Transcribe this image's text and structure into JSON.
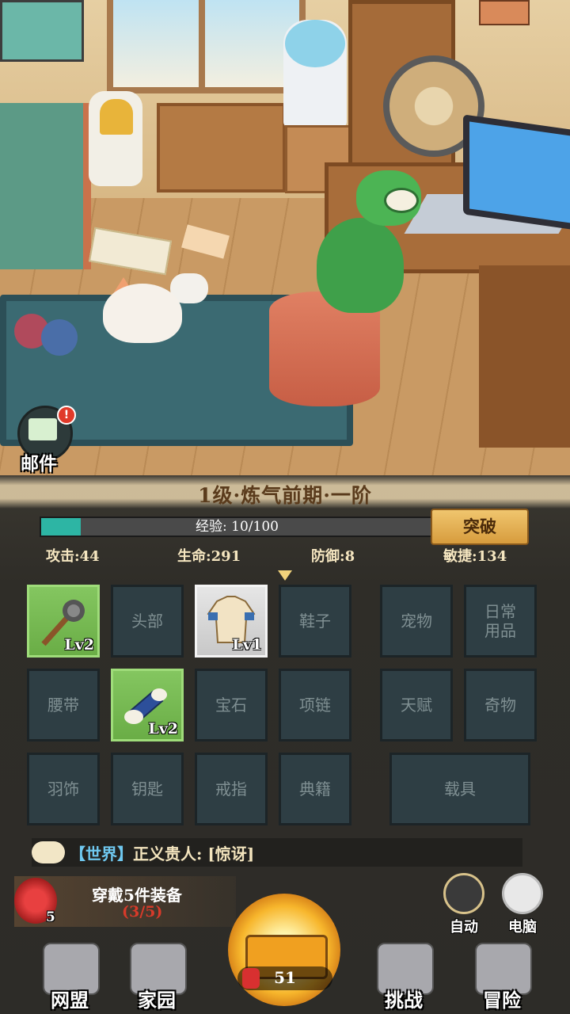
{
  "mail": {
    "label": "邮件",
    "badge": "!"
  },
  "realm": {
    "title": "1级·炼气前期·一阶"
  },
  "exp": {
    "label": "经验:",
    "value": "10/100",
    "progress": 0.1
  },
  "breakthrough_label": "突破",
  "stats": [
    {
      "text": "攻击:44"
    },
    {
      "text": "生命:291"
    },
    {
      "text": "防御:8"
    },
    {
      "text": "敏捷:134"
    }
  ],
  "slots": [
    {
      "label": "",
      "level": "Lv2",
      "icon": "mace-icon",
      "state": "green"
    },
    {
      "label": "头部",
      "level": "",
      "state": "empty"
    },
    {
      "label": "",
      "level": "Lv1",
      "icon": "shirt-icon",
      "state": "grey"
    },
    {
      "label": "鞋子",
      "level": "",
      "state": "empty"
    },
    {
      "label": "宠物",
      "level": "",
      "state": "empty"
    },
    {
      "label": "日常\n用品",
      "level": "",
      "state": "empty"
    },
    {
      "label": "腰带",
      "level": "",
      "state": "empty"
    },
    {
      "label": "",
      "level": "Lv2",
      "icon": "bracer-icon",
      "state": "green"
    },
    {
      "label": "宝石",
      "level": "",
      "state": "empty"
    },
    {
      "label": "项链",
      "level": "",
      "state": "empty"
    },
    {
      "label": "天赋",
      "level": "",
      "state": "empty"
    },
    {
      "label": "奇物",
      "level": "",
      "state": "empty"
    },
    {
      "label": "羽饰",
      "level": "",
      "state": "empty"
    },
    {
      "label": "钥匙",
      "level": "",
      "state": "empty"
    },
    {
      "label": "戒指",
      "level": "",
      "state": "empty"
    },
    {
      "label": "典籍",
      "level": "",
      "state": "empty"
    },
    {
      "label": "载具",
      "level": "",
      "state": "empty"
    }
  ],
  "chat": {
    "channel": "【世界】",
    "message": "正义贵人: [惊讶]"
  },
  "quest": {
    "title": "穿戴5件装备",
    "progress": "(3/5)",
    "item_count": "5"
  },
  "auto_label": "自动",
  "pc_label": "电脑",
  "energy_count": "51",
  "nav": [
    {
      "label": "网盟",
      "icon": "flag-icon"
    },
    {
      "label": "家园",
      "icon": "house-icon"
    },
    {
      "label": "挑战",
      "icon": "compass-icon"
    },
    {
      "label": "冒险",
      "icon": "target-icon"
    }
  ],
  "colors": {
    "exp_fill": "#2db5a4",
    "slot_equipped": "#84c660",
    "accent_gold": "#f0c66e"
  }
}
